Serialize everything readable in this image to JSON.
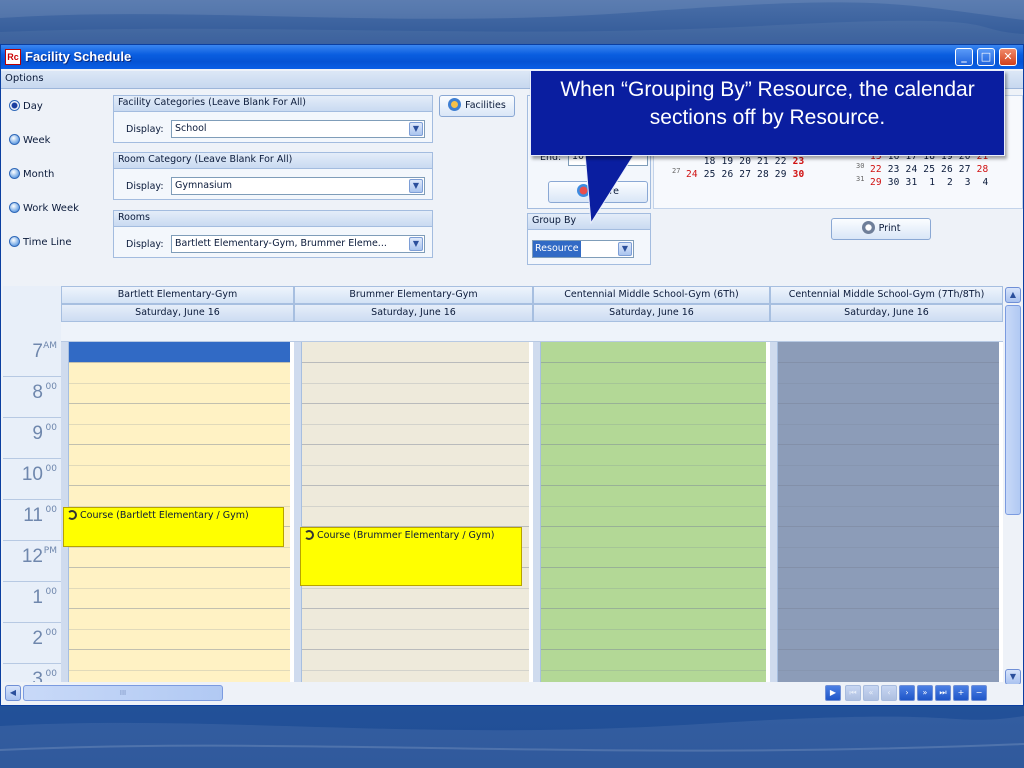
{
  "window": {
    "title": "Facility Schedule",
    "options_label": "Options"
  },
  "view_modes": [
    {
      "label": "Day",
      "selected": true
    },
    {
      "label": "Week",
      "selected": false
    },
    {
      "label": "Month",
      "selected": false
    },
    {
      "label": "Work Week",
      "selected": false
    },
    {
      "label": "Time Line",
      "selected": false
    }
  ],
  "filters": {
    "facility": {
      "header": "Facility Categories (Leave Blank For All)",
      "display_label": "Display:",
      "value": "School"
    },
    "room": {
      "header": "Room Category (Leave Blank For All)",
      "display_label": "Display:",
      "value": "Gymnasium"
    },
    "rooms": {
      "header": "Rooms",
      "display_label": "Display:",
      "value": "Bartlett Elementary-Gym, Brummer Eleme..."
    }
  },
  "facilities_button": "Facilities",
  "end_label": "End:",
  "end_value": "10:00 P",
  "refresh_button": "Refre",
  "group_by": {
    "header": "Group By",
    "value": "Resource"
  },
  "print_button": "Print",
  "mini_calendar": {
    "left_rows": [
      {
        "week": "",
        "days": "   18 19 20 21 22 ",
        "last": "23"
      },
      {
        "week": "27",
        "first": "24",
        "days": " 25 26 27 28 29 ",
        "last": "30"
      }
    ],
    "right_rows": [
      {
        "week": "29",
        "first": "15",
        "days": " 16 17 18 19 20 ",
        "last": "21"
      },
      {
        "week": "30",
        "first": "22",
        "days": " 23 24 25 26 27 ",
        "last": "28"
      },
      {
        "week": "31",
        "first": "29",
        "days": " 30 31  1  2  3  4",
        "last": ""
      }
    ]
  },
  "resources": [
    {
      "name": "Bartlett Elementary-Gym",
      "date": "Saturday, June 16",
      "color": "#fff2c4"
    },
    {
      "name": "Brummer Elementary-Gym",
      "date": "Saturday, June 16",
      "color": "#eeeadb"
    },
    {
      "name": "Centennial Middle School-Gym (6Th)",
      "date": "Saturday, June 16",
      "color": "#b3d896"
    },
    {
      "name": "Centennial Middle School-Gym (7Th/8Th)",
      "date": "Saturday, June 16",
      "color": "#8c9cb8"
    }
  ],
  "hours": [
    {
      "h": "7",
      "m": "AM"
    },
    {
      "h": "8",
      "m": "00"
    },
    {
      "h": "9",
      "m": "00"
    },
    {
      "h": "10",
      "m": "00"
    },
    {
      "h": "11",
      "m": "00"
    },
    {
      "h": "12",
      "m": "PM"
    },
    {
      "h": "1",
      "m": "00"
    },
    {
      "h": "2",
      "m": "00"
    },
    {
      "h": "3",
      "m": "00"
    }
  ],
  "appointments": [
    {
      "resource": 0,
      "text": "Course (Bartlett Elementary / Gym)"
    },
    {
      "resource": 1,
      "text": "Course (Brummer Elementary / Gym)"
    }
  ],
  "hscroll_thumb_label": "III",
  "callout": {
    "text": "When “Grouping By” Resource, the calendar sections off by Resource."
  },
  "colors": {
    "title_bar": "#0553d4",
    "accent_selection": "#316ac5",
    "appointment": "#ffff00",
    "callout_bg": "#0a1ea0"
  }
}
